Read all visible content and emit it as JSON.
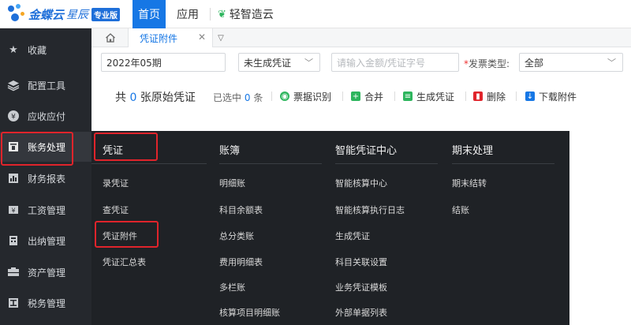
{
  "topbar": {
    "brand": "金蝶云",
    "brand_sub": "星辰",
    "edition_badge": "专业版",
    "nav_home": "首页",
    "nav_app": "应用",
    "nav_smart": "轻智造云"
  },
  "sidebar": {
    "items": [
      {
        "label": "收藏",
        "icon": "star-icon"
      },
      {
        "label": "配置工具",
        "icon": "layers-icon"
      },
      {
        "label": "应收应付",
        "icon": "coin-icon"
      },
      {
        "label": "账务处理",
        "icon": "ledger-icon"
      },
      {
        "label": "财务报表",
        "icon": "report-icon"
      },
      {
        "label": "工资管理",
        "icon": "salary-icon"
      },
      {
        "label": "出纳管理",
        "icon": "cashier-icon"
      },
      {
        "label": "资产管理",
        "icon": "asset-icon"
      },
      {
        "label": "税务管理",
        "icon": "tax-icon"
      }
    ]
  },
  "tabs": {
    "active_tab": "凭证附件"
  },
  "filters": {
    "period": "2022年05期",
    "status": "未生成凭证",
    "search_placeholder": "请输入金额/凭证字号",
    "invoice_type_label": "发票类型:",
    "invoice_type_value": "全部"
  },
  "toolbar": {
    "count_prefix": "共",
    "count_value": "0",
    "count_suffix": "张原始凭证",
    "selected_prefix": "已选中",
    "selected_value": "0",
    "selected_suffix": "条",
    "btn_ocr": "票据识别",
    "btn_merge": "合并",
    "btn_generate": "生成凭证",
    "btn_delete": "删除",
    "btn_download": "下载附件"
  },
  "mega_menu": {
    "columns": [
      {
        "title": "凭证",
        "items": [
          "录凭证",
          "查凭证",
          "凭证附件",
          "凭证汇总表"
        ]
      },
      {
        "title": "账簿",
        "items": [
          "明细账",
          "科目余额表",
          "总分类账",
          "费用明细表",
          "多栏账",
          "核算项目明细账"
        ]
      },
      {
        "title": "智能凭证中心",
        "items": [
          "智能核算中心",
          "智能核算执行日志",
          "生成凭证",
          "科目关联设置",
          "业务凭证模板",
          "外部单据列表"
        ]
      },
      {
        "title": "期末处理",
        "items": [
          "期末结转",
          "结账"
        ]
      }
    ]
  },
  "colors": {
    "accent": "#1677e5",
    "sidebar_bg": "#25282d",
    "menu_bg": "#1f2226",
    "highlight": "#e0242b"
  }
}
